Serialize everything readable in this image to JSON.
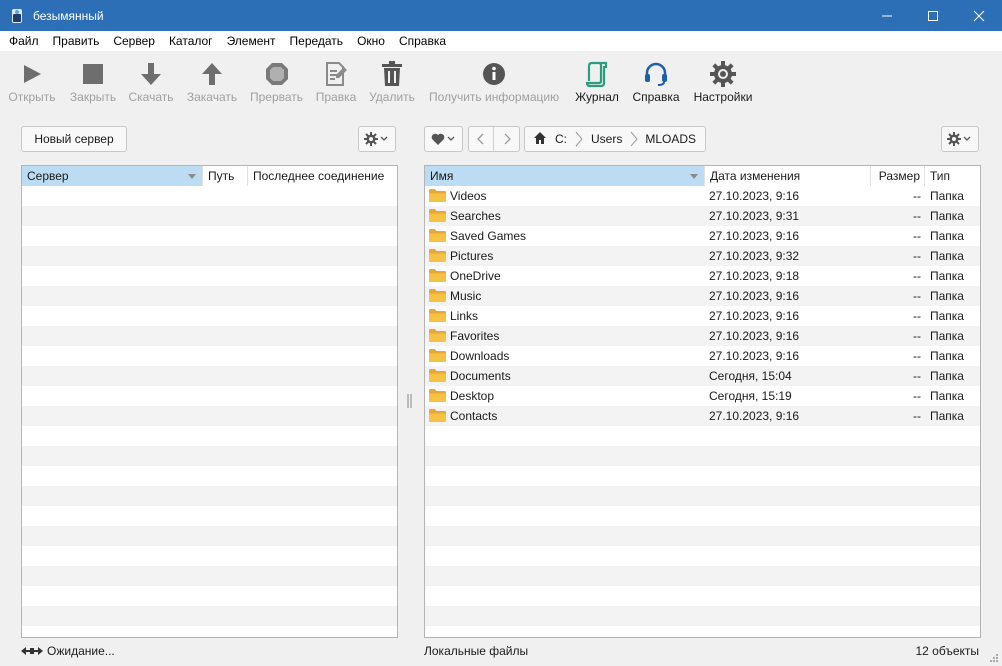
{
  "window": {
    "title": "безымянный"
  },
  "menu": [
    "Файл",
    "Править",
    "Сервер",
    "Каталог",
    "Элемент",
    "Передать",
    "Окно",
    "Справка"
  ],
  "toolbar": {
    "open": "Открыть",
    "close": "Закрыть",
    "download": "Скачать",
    "upload": "Закачать",
    "stop": "Прервать",
    "edit": "Правка",
    "delete": "Удалить",
    "info": "Получить информацию",
    "log": "Журнал",
    "help": "Справка",
    "settings": "Настройки"
  },
  "left": {
    "new_server": "Новый сервер",
    "columns": [
      "Сервер",
      "Путь",
      "Последнее соединение"
    ],
    "status": "Ожидание..."
  },
  "right": {
    "breadcrumb": [
      "C:",
      "Users",
      "MLOADS"
    ],
    "columns": [
      "Имя",
      "Дата изменения",
      "Размер",
      "Тип"
    ],
    "files": [
      {
        "name": "Videos",
        "date": "27.10.2023, 9:16",
        "size": "--",
        "type": "Папка"
      },
      {
        "name": "Searches",
        "date": "27.10.2023, 9:31",
        "size": "--",
        "type": "Папка"
      },
      {
        "name": "Saved Games",
        "date": "27.10.2023, 9:16",
        "size": "--",
        "type": "Папка"
      },
      {
        "name": "Pictures",
        "date": "27.10.2023, 9:32",
        "size": "--",
        "type": "Папка"
      },
      {
        "name": "OneDrive",
        "date": "27.10.2023, 9:18",
        "size": "--",
        "type": "Папка"
      },
      {
        "name": "Music",
        "date": "27.10.2023, 9:16",
        "size": "--",
        "type": "Папка"
      },
      {
        "name": "Links",
        "date": "27.10.2023, 9:16",
        "size": "--",
        "type": "Папка"
      },
      {
        "name": "Favorites",
        "date": "27.10.2023, 9:16",
        "size": "--",
        "type": "Папка"
      },
      {
        "name": "Downloads",
        "date": "27.10.2023, 9:16",
        "size": "--",
        "type": "Папка"
      },
      {
        "name": "Documents",
        "date": "Сегодня, 15:04",
        "size": "--",
        "type": "Папка"
      },
      {
        "name": "Desktop",
        "date": "Сегодня, 15:19",
        "size": "--",
        "type": "Папка"
      },
      {
        "name": "Contacts",
        "date": "27.10.2023, 9:16",
        "size": "--",
        "type": "Папка"
      }
    ],
    "status_left": "Локальные файлы",
    "status_right": "12 объекты"
  },
  "colors": {
    "titlebar": "#2c6fb7",
    "header_selected": "#bcdcf4",
    "folder": "#f5c243",
    "accent_green": "#2a9d7c",
    "accent_blue": "#1f5fa8"
  }
}
